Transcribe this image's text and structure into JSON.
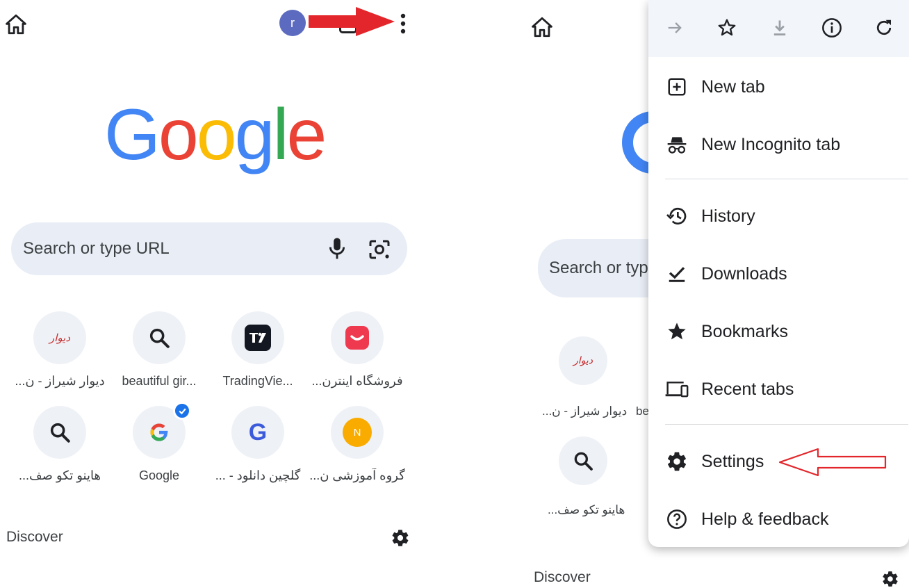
{
  "search": {
    "placeholder": "Search or type URL",
    "placeholder_truncated": "Search or type"
  },
  "profile": {
    "initial": "r"
  },
  "logo": {
    "letters": [
      "G",
      "o",
      "o",
      "g",
      "l",
      "e"
    ]
  },
  "shortcuts": [
    {
      "label": "دیوار شیراز - ن...",
      "icon": "divar-logo",
      "logo_text": "دیوار"
    },
    {
      "label": "beautiful gir...",
      "icon": "search-icon"
    },
    {
      "label": "TradingVie...",
      "icon": "tradingview-logo"
    },
    {
      "label": "فروشگاه اینترن...",
      "icon": "digikala-logo"
    },
    {
      "label": "هاینو تکو صف...",
      "icon": "search-icon"
    },
    {
      "label": "Google",
      "icon": "google-g-logo"
    },
    {
      "label": "گلچین دانلود - ...",
      "icon": "g-letter-logo",
      "logo_text": "G"
    },
    {
      "label": "گروه آموزشی ن...",
      "icon": "n-letter-logo",
      "logo_text": "N"
    }
  ],
  "right_partial": {
    "shortcut_label_1": "دیوار شیراز - ن...",
    "shortcut_label_2": "be",
    "shortcut_label_3": "هاینو تکو صف..."
  },
  "discover": {
    "label": "Discover"
  },
  "menu": {
    "toolbar": [
      "forward-icon",
      "star-icon",
      "download-icon",
      "info-icon",
      "reload-icon"
    ],
    "items": [
      {
        "label": "New tab",
        "icon": "new-tab-icon"
      },
      {
        "label": "New Incognito tab",
        "icon": "incognito-icon"
      },
      {
        "label": "History",
        "icon": "history-icon"
      },
      {
        "label": "Downloads",
        "icon": "downloads-icon"
      },
      {
        "label": "Bookmarks",
        "icon": "bookmarks-star-icon"
      },
      {
        "label": "Recent tabs",
        "icon": "recent-tabs-icon"
      },
      {
        "label": "Settings",
        "icon": "settings-gear-icon"
      },
      {
        "label": "Help & feedback",
        "icon": "help-icon"
      }
    ]
  },
  "colors": {
    "annotation_red": "#e3262b",
    "search_bg": "#e9eef6",
    "menu_top_bg": "#f2f5fa"
  }
}
